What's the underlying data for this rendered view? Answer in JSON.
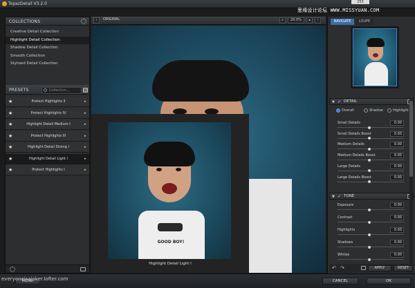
{
  "title": "TopazDetail V3.2.0",
  "watermark_top": "思缘设计论坛 WWW.MISSYUAN.COM",
  "watermark_bottom": "everyoneisajoker.lofter.com",
  "badge_value": "255",
  "collections": {
    "header": "COLLECTIONS",
    "items": [
      {
        "label": "Creative Detail Collection",
        "selected": false
      },
      {
        "label": "Highlight Detail Collection",
        "selected": true
      },
      {
        "label": "Shadow Detail Collection",
        "selected": false
      },
      {
        "label": "Smooth Collection",
        "selected": false
      },
      {
        "label": "Stylized Detail Collection",
        "selected": false
      }
    ]
  },
  "presets": {
    "header": "PRESETS",
    "dropdown_placeholder": "Collection...",
    "items": [
      {
        "label": "Protect Highlights II",
        "selected": false
      },
      {
        "label": "Protect Highlights IV",
        "selected": false
      },
      {
        "label": "Highlight Detail Medium I",
        "selected": false
      },
      {
        "label": "Protect Highlights III",
        "selected": false
      },
      {
        "label": "Highlight Detail Strong I",
        "selected": false
      },
      {
        "label": "Highlight Detail Light I",
        "selected": true
      },
      {
        "label": "Protect Highlights I",
        "selected": false
      }
    ]
  },
  "canvas": {
    "original_label": "ORIGINAL",
    "zoom": "20.0%",
    "loupe_caption": "Highlight Detail Light I"
  },
  "right_panel": {
    "tabs": [
      {
        "label": "NAVIGATE",
        "active": true
      },
      {
        "label": "LOUPE",
        "active": false
      }
    ],
    "detail": {
      "header": "DETAIL",
      "radios": [
        {
          "label": "Overall",
          "selected": true
        },
        {
          "label": "Shadow",
          "selected": false
        },
        {
          "label": "Highlight",
          "selected": false
        }
      ],
      "sliders": [
        {
          "label": "Small Details",
          "value": "0.00"
        },
        {
          "label": "Small Details Boost",
          "value": "0.00"
        },
        {
          "label": "Medium Details",
          "value": "0.00"
        },
        {
          "label": "Medium Details Boost",
          "value": "0.00"
        },
        {
          "label": "Large Details",
          "value": "0.00"
        },
        {
          "label": "Large Details Boost",
          "value": "0.00"
        }
      ]
    },
    "tone": {
      "header": "TONE",
      "sliders": [
        {
          "label": "Exposure",
          "value": "0.00"
        },
        {
          "label": "Contrast",
          "value": "0.00"
        },
        {
          "label": "Highlights",
          "value": "0.00"
        },
        {
          "label": "Shadows",
          "value": "0.00"
        },
        {
          "label": "Whites",
          "value": "0.00"
        }
      ]
    },
    "apply_label": "APPLY",
    "reset_label": "RESET"
  },
  "bottom": {
    "menu_label": "MENU",
    "cancel_label": "CANCEL",
    "ok_label": "OK"
  },
  "colors": {
    "accent": "#3a6ea8",
    "background": "#1b1b1b",
    "panel": "#2c2e30"
  }
}
